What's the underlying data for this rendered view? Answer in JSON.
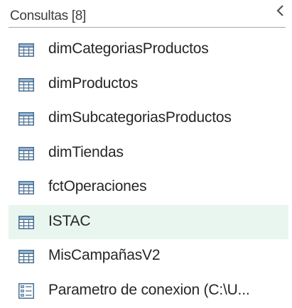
{
  "queries_pane": {
    "title": "Consultas [8]",
    "collapse_icon": "chevron-left-icon",
    "accent_color": "#e9f5ef",
    "items": [
      {
        "label": "dimCategoriasProductos",
        "icon": "table-icon",
        "selected": false
      },
      {
        "label": "dimProductos",
        "icon": "table-icon",
        "selected": false
      },
      {
        "label": "dimSubcategoriasProductos",
        "icon": "table-icon",
        "selected": false
      },
      {
        "label": "dimTiendas",
        "icon": "table-icon",
        "selected": false
      },
      {
        "label": "fctOperaciones",
        "icon": "table-icon",
        "selected": false
      },
      {
        "label": "ISTAC",
        "icon": "table-icon",
        "selected": true
      },
      {
        "label": "MisCampañasV2",
        "icon": "table-icon",
        "selected": false
      },
      {
        "label": "Parametro de conexion (C:\\U...",
        "icon": "parameter-icon",
        "selected": false
      }
    ]
  }
}
